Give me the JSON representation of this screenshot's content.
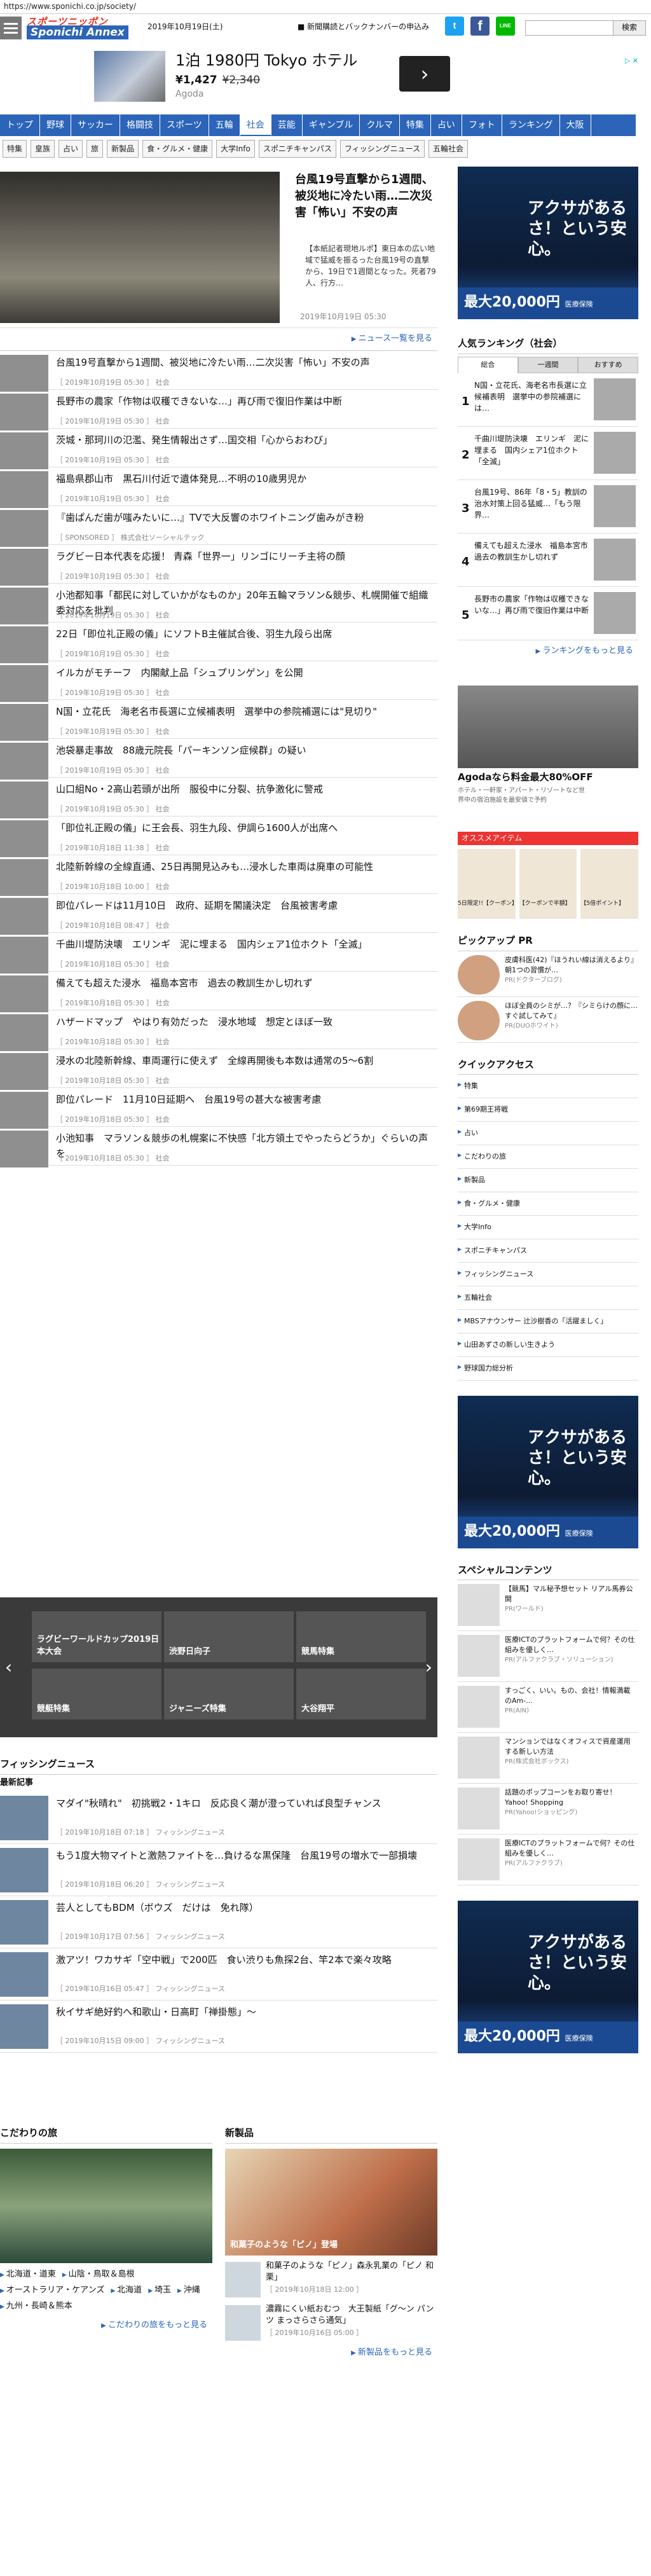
{
  "url": "https://www.sponichi.co.jp/society/",
  "logo": {
    "top": "スポーツニッポン",
    "main": "Sponichi Annex"
  },
  "header": {
    "date": "2019年10月19日(土)",
    "notice": "新聞購読とバックナンバーの申込み",
    "search_button": "検索",
    "search_placeholder": ""
  },
  "social": {
    "twitter": "t",
    "facebook": "f",
    "line": "LINE"
  },
  "ad_top": {
    "title": "1泊 1980円 Tokyo ホテル",
    "price": "¥1,427",
    "old_price": "¥2,340",
    "brand": "Agoda",
    "choice": "▷ ✕"
  },
  "nav": [
    {
      "label": "トップ"
    },
    {
      "label": "野球"
    },
    {
      "label": "サッカー"
    },
    {
      "label": "格闘技"
    },
    {
      "label": "スポーツ"
    },
    {
      "label": "五輪"
    },
    {
      "label": "社会"
    },
    {
      "label": "芸能"
    },
    {
      "label": "ギャンブル"
    },
    {
      "label": "クルマ"
    },
    {
      "label": "特集"
    },
    {
      "label": "占い"
    },
    {
      "label": "フォト"
    },
    {
      "label": "ランキング"
    },
    {
      "label": "大阪"
    }
  ],
  "nav_active": 6,
  "subnav": [
    {
      "label": "特集"
    },
    {
      "label": "皇族"
    },
    {
      "label": "占い"
    },
    {
      "label": "旅"
    },
    {
      "label": "新製品"
    },
    {
      "label": "食・グルメ・健康"
    },
    {
      "label": "大学Info"
    },
    {
      "label": "スポニチキャンパス"
    },
    {
      "label": "フィッシングニュース"
    },
    {
      "label": "五輪社会"
    }
  ],
  "lead": {
    "title": "台風19号直撃から1週間、被災地に冷たい雨…二次災害「怖い」不安の声",
    "text": "【本紙記者現地ルポ】東日本の広い地域で猛威を振るった台風19号の直撃から、19日で1週間となった。死者79人、行方…",
    "time": "2019年10月19日 05:30"
  },
  "more_news": "ニュース一覧を見る",
  "news": [
    {
      "title": "台風19号直撃から1週間、被災地に冷たい雨…二次災害「怖い」不安の声",
      "meta": "［ 2019年10月19日 05:30 ］ 社会"
    },
    {
      "title": "長野市の農家「作物は収穫できないな…」再び雨で復旧作業は中断",
      "meta": "［ 2019年10月19日 05:30 ］ 社会"
    },
    {
      "title": "茨城・那珂川の氾濫、発生情報出さず…国交相「心からおわび」",
      "meta": "［ 2019年10月19日 05:30 ］ 社会"
    },
    {
      "title": "福島県郡山市　黒石川付近で遺体発見…不明の10歳男児か",
      "meta": "［ 2019年10月19日 05:30 ］ 社会"
    },
    {
      "title": "『歯ぱんだ歯が嗤みたいに…』TVで大反響のホワイトニング歯みがき粉",
      "meta": "［ SPONSORED ］ 株式会社ソーシャルテック"
    },
    {
      "title": "ラグビー日本代表を応援！ 青森「世界一」リンゴにリーチ主将の顔",
      "meta": "［ 2019年10月19日 05:30 ］ 社会"
    },
    {
      "title": "小池都知事「都民に対していかがなものか」20年五輪マラソン&競歩、札幌開催で組織委対応を批判",
      "meta": "［ 2019年10月19日 05:30 ］ 社会"
    },
    {
      "title": "22日「即位礼正殿の儀」にソフトB主催試合後、羽生九段ら出席",
      "meta": "［ 2019年10月19日 05:30 ］ 社会"
    },
    {
      "title": "イルカがモチーフ　内閣献上品「シュプリンゲン」を公開",
      "meta": "［ 2019年10月19日 05:30 ］ 社会"
    },
    {
      "title": "N国・立花氏　海老名市長選に立候補表明　選挙中の参院補選には\"見切り\"",
      "meta": "［ 2019年10月19日 05:30 ］ 社会"
    },
    {
      "title": "池袋暴走事故　88歳元院長「パーキンソン症候群」の疑い",
      "meta": "［ 2019年10月19日 05:30 ］ 社会"
    },
    {
      "title": "山口組No・2高山若頭が出所　服役中に分裂、抗争激化に警戒",
      "meta": "［ 2019年10月19日 05:30 ］ 社会"
    },
    {
      "title": "「即位礼正殿の儀」に王会長、羽生九段、伊調ら1600人が出席へ",
      "meta": "［ 2019年10月18日 11:38 ］ 社会"
    },
    {
      "title": "北陸新幹線の全線直通、25日再開見込みも…浸水した車両は廃車の可能性",
      "meta": "［ 2019年10月18日 10:00 ］ 社会"
    },
    {
      "title": "即位パレードは11月10日　政府、延期を閣議決定　台風被害考慮",
      "meta": "［ 2019年10月18日 08:47 ］ 社会"
    },
    {
      "title": "千曲川堤防決壊　エリンギ　泥に埋まる　国内シェア1位ホクト「全滅」",
      "meta": "［ 2019年10月18日 05:30 ］ 社会"
    },
    {
      "title": "備えても超えた浸水　福島本宮市　過去の教訓生かし切れず",
      "meta": "［ 2019年10月18日 05:30 ］ 社会"
    },
    {
      "title": "ハザードマップ　やはり有効だった　浸水地域　想定とほぼ一致",
      "meta": "［ 2019年10月18日 05:30 ］ 社会"
    },
    {
      "title": "浸水の北陸新幹線、車両運行に使えず　全線再開後も本数は通常の5～6割",
      "meta": "［ 2019年10月18日 05:30 ］ 社会"
    },
    {
      "title": "即位パレード　11月10日延期へ　台風19号の甚大な被害考慮",
      "meta": "［ 2019年10月18日 05:30 ］ 社会"
    },
    {
      "title": "小池知事　マラソン＆競歩の札幌案に不快感「北方領土でやったらどうか」ぐらいの声を",
      "meta": "［ 2019年10月18日 05:30 ］ 社会"
    }
  ],
  "slider": [
    {
      "label": "ラグビーワールドカップ2019日本大会"
    },
    {
      "label": "渋野日向子"
    },
    {
      "label": "競馬特集"
    },
    {
      "label": "競艇特集"
    },
    {
      "label": "ジャニーズ特集"
    },
    {
      "label": "大谷翔平"
    }
  ],
  "fishing": {
    "title": "フィッシングニュース",
    "sub": "最新記事",
    "items": [
      {
        "title": "マダイ\"秋晴れ\"　初挑戦2・1キロ　反応良く潮が澄っていれば良型チャンス",
        "meta": "［ 2019年10月18日 07:18 ］ フィッシングニュース"
      },
      {
        "title": "もう1度大物マイトと激熱ファイトを…負けるな黒保隆　台風19号の増水で一部損壊",
        "meta": "［ 2019年10月18日 06:20 ］ フィッシングニュース"
      },
      {
        "title": "芸人としてもBDM（ボウズ　だけは　免れ隊）",
        "meta": "［ 2019年10月17日 07:56 ］ フィッシングニュース"
      },
      {
        "title": "激アツ！ワカサギ「空中戦」で200匹　食い渋りも魚探2台、竿2本で楽々攻略",
        "meta": "［ 2019年10月16日 05:47 ］ フィッシングニュース"
      },
      {
        "title": "秋イサギ絶好釣へ和歌山・日高町「禅掛態」～",
        "meta": "［ 2019年10月15日 09:00 ］ フィッシングニュース"
      }
    ]
  },
  "kodawari": {
    "title": "こだわりの旅",
    "links": [
      "北海道・道東",
      "山陰・鳥取＆島根",
      "オーストラリア・ケアンズ",
      "北海道",
      "埼玉",
      "沖縄",
      "九州・長崎＆熊本"
    ],
    "more": "こだわりの旅をもっと見る"
  },
  "shinseihin": {
    "title": "新製品",
    "pic_caption": "和菓子のような「ピノ」登場",
    "items": [
      {
        "title": "和菓子のような「ピノ」森永乳業の「ピノ 和栗」",
        "meta": "［ 2019年10月18日 12:00 ］"
      },
      {
        "title": "濃霧にくい紙おむつ　大王製紙「グ～ン パンツ まっさらさら通気」",
        "meta": "［ 2019年10月16日 05:00 ］"
      }
    ],
    "more": "新製品をもっと見る"
  },
  "right_ad": {
    "headline": "アクサがあるさ！という安心。",
    "bottom": "最大20,000円",
    "bottom_note": "医療保険"
  },
  "ranking": {
    "title": "人気ランキング（社会）",
    "tabs": [
      "総合",
      "一週間",
      "おすすめ"
    ],
    "items": [
      {
        "n": "1",
        "title": "N国・立花氏、海老名市長選に立候補表明　選挙中の参院補選には…"
      },
      {
        "n": "2",
        "title": "千曲川堤防決壊　エリンギ　泥に埋まる　国内シェア1位ホクト「全滅」"
      },
      {
        "n": "3",
        "title": "台風19号、86年「8・5」教訓の治水対策上回る猛威…「もう限界…"
      },
      {
        "n": "4",
        "title": "備えても超えた浸水　福島本宮市　過去の教訓生かし切れず"
      },
      {
        "n": "5",
        "title": "長野市の農家「作物は収穫できないな…」再び雨で復旧作業は中断"
      }
    ],
    "more": "ランキングをもっと見る"
  },
  "agoda_ad": {
    "title": "Agodaなら料金最大80%OFF",
    "desc": "ホテル・一軒家・アパート・リゾートなど世界中の宿泊施設を最安値で予約"
  },
  "osusume": {
    "title": "オススメアイテム",
    "items": [
      "5日限定!!【クーポン】",
      "【クーポンで半額】",
      "【5倍ポイント】"
    ]
  },
  "pickup": {
    "title": "ピックアップ PR",
    "items": [
      {
        "title": "皮膚科医(42)『ほうれい線は消えるより』朝1つの習慣が…",
        "pr": "PR(ドクターブログ)"
      },
      {
        "title": "ほぼ全員のシミが…？『シミらけの顔に…すぐ試してみて』",
        "pr": "PR(DUOホワイト)"
      }
    ]
  },
  "quickaccess": {
    "title": "クイックアクセス",
    "items": [
      "特集",
      "第69期王将戦",
      "占い",
      "こだわりの旅",
      "新製品",
      "食・グルメ・健康",
      "大学Info",
      "スポニチキャンパス",
      "フィッシングニュース",
      "五輪社会",
      "MBSアナウンサー 辻沙樹香の「活躍ましく」",
      "山田あずさの新しい生きよう",
      "野球国力総分析"
    ]
  },
  "special": {
    "title": "スペシャルコンテンツ",
    "items": [
      {
        "title": "【競馬】マル秘予想セット リアル馬券公開",
        "pr": "PR(ワールド)"
      },
      {
        "title": "医療ICTのプラットフォームで何？その仕組みを優しく…",
        "pr": "PR(アルファクラブ・ソリューション)"
      },
      {
        "title": "すっごく、いい。もの、会社！情報満載のAm-...",
        "pr": "PR(AIN)"
      },
      {
        "title": "マンションではなくオフィスで資産運用する新しい方法",
        "pr": "PR(株式会社ボックス)"
      },
      {
        "title": "話題のポップコーンをお取り寄せ！Yahoo! Shopping",
        "pr": "PR(Yahoo!ショッピング)"
      },
      {
        "title": "医療ICTのプラットフォームで何？その仕組みを優しく…",
        "pr": "PR(アルファクラブ)"
      }
    ]
  }
}
